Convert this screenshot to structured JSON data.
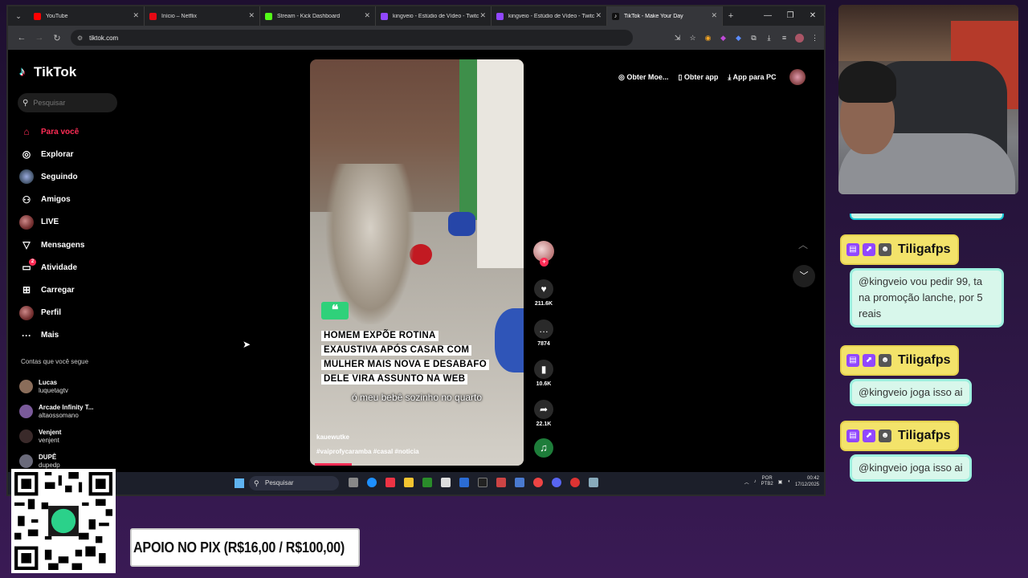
{
  "browser": {
    "tabs": [
      {
        "title": "YouTube",
        "color": "#ff0000"
      },
      {
        "title": "Início – Netflix",
        "color": "#e50914"
      },
      {
        "title": "Stream - Kick Dashboard",
        "color": "#53fc18"
      },
      {
        "title": "kingveio - Estúdio de Vídeo - Twitc",
        "color": "#9147ff"
      },
      {
        "title": "kingveio - Estúdio de Vídeo - Twitc",
        "color": "#9147ff"
      },
      {
        "title": "TikTok - Make Your Day",
        "color": "#111111"
      }
    ],
    "url": "tiktok.com"
  },
  "tiktok": {
    "logo": "TikTok",
    "search_placeholder": "Pesquisar",
    "nav": [
      {
        "label": "Para você",
        "icon": "home-icon",
        "glyph": "⌂"
      },
      {
        "label": "Explorar",
        "icon": "compass-icon",
        "glyph": "◎"
      },
      {
        "label": "Seguindo",
        "icon": "following-avatar",
        "glyph": ""
      },
      {
        "label": "Amigos",
        "icon": "friends-icon",
        "glyph": "⚇"
      },
      {
        "label": "LIVE",
        "icon": "live-avatar",
        "glyph": ""
      },
      {
        "label": "Mensagens",
        "icon": "messages-icon",
        "glyph": "▽"
      },
      {
        "label": "Atividade",
        "icon": "activity-icon",
        "glyph": "▭",
        "badge": "2"
      },
      {
        "label": "Carregar",
        "icon": "upload-icon",
        "glyph": "⊞"
      },
      {
        "label": "Perfil",
        "icon": "profile-avatar",
        "glyph": ""
      },
      {
        "label": "Mais",
        "icon": "more-icon",
        "glyph": "···"
      }
    ],
    "following_header": "Contas que você segue",
    "following": [
      {
        "name": "Lucas",
        "handle": "luquetagtv",
        "color": "#8a6d5a"
      },
      {
        "name": "Arcade Infinity T...",
        "handle": "altaossomano",
        "color": "#7a5a9a"
      },
      {
        "name": "Venjent",
        "handle": "venjent",
        "color": "#3a2a2a"
      },
      {
        "name": "DUPÊ",
        "handle": "dupedp",
        "color": "#6a6a7a"
      }
    ],
    "top_links": {
      "coins": "Obter Moe...",
      "app": "Obter app",
      "pc": "App para PC"
    },
    "video": {
      "headline": [
        "HOMEM EXPÕE ROTINA",
        "EXAUSTIVA APÓS CASAR COM",
        "MULHER MAIS NOVA E DESABAFO",
        "DELE VIRA ASSUNTO NA WEB"
      ],
      "caption": "ó meu bebê sozinho no quarto",
      "author": "kauewutke",
      "tags": "#vaiprofycaramba #casal #noticia"
    },
    "actions": {
      "likes": "211.6K",
      "comments": "7874",
      "saves": "10.6K",
      "shares": "22.1K"
    }
  },
  "taskbar": {
    "search": "Pesquisar",
    "lang": "POR",
    "layout": "PTB2",
    "time": "00:42",
    "date": "17/12/2025"
  },
  "chat": [
    {
      "user": "Tiligafps",
      "message": "@kingveio vou pedir 99, ta na promoção lanche, por 5 reais"
    },
    {
      "user": "Tiligafps",
      "message": "@kingveio joga isso ai"
    },
    {
      "user": "Tiligafps",
      "message": "@kingveio joga isso ai"
    }
  ],
  "pix_banner": "APOIO NO PIX (R$16,00 / R$100,00)"
}
